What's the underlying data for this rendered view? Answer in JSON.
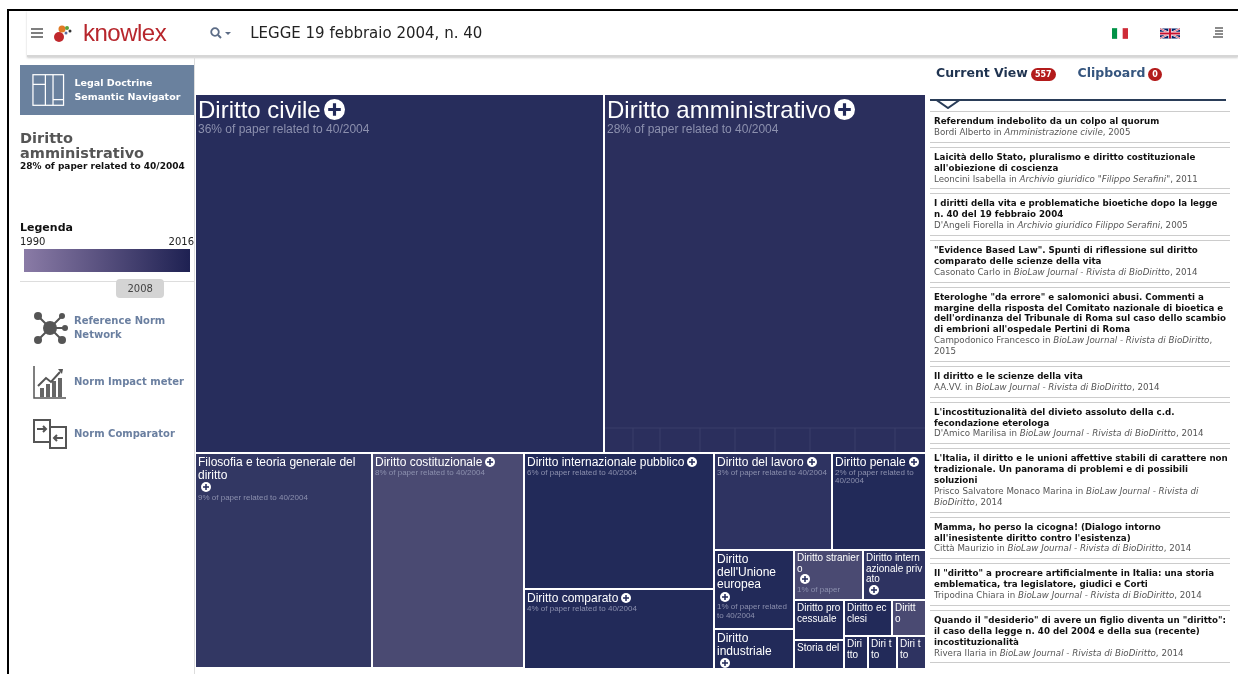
{
  "header": {
    "logo": "knowlex",
    "query": "LEGGE 19 febbraio 2004, n. 40"
  },
  "sidebar": {
    "app_title": "Legal Doctrine Semantic Navigator",
    "selected_title": "Diritto amministrativo",
    "selected_subtitle": "28% of paper related to 40/2004",
    "legend": {
      "title": "Legenda",
      "start": "1990",
      "end": "2016",
      "level": 0.7,
      "marker": "2008"
    },
    "tools": [
      {
        "kind": "network",
        "label": "Reference Norm Network"
      },
      {
        "kind": "meter",
        "label": "Norm Impact meter"
      },
      {
        "kind": "compare",
        "label": "Norm Comparator"
      }
    ]
  },
  "treemap": {
    "tiles": [
      {
        "title": "Diritto civile",
        "subtitle": "36% of paper related to 40/2004",
        "expandable": true,
        "color": "#272d5c"
      },
      {
        "title": "Diritto amministrativo",
        "subtitle": "28% of paper related to 40/2004",
        "expandable": true,
        "color": "#2b2f5d"
      },
      {
        "title": "Filosofia e teoria generale del diritto",
        "subtitle": "9% of paper related to 40/2004",
        "expandable": true,
        "color": "#323763"
      },
      {
        "title": "Diritto costituzionale",
        "subtitle": "8% of paper related to 40/2004",
        "expandable": true,
        "color": "#4a4a72"
      },
      {
        "title": "Diritto internazionale pubblico",
        "subtitle": "6% of paper related to 40/2004",
        "expandable": true,
        "color": "#222a59"
      },
      {
        "title": "Diritto comparato",
        "subtitle": "4% of paper related to 40/2004",
        "expandable": true,
        "color": "#222a59"
      },
      {
        "title": "Diritto del lavoro",
        "subtitle": "3% of paper related to 40/2004",
        "expandable": true,
        "color": "#2e3361"
      },
      {
        "title": "Diritto penale",
        "subtitle": "2% of paper related to 40/2004",
        "expandable": true,
        "color": "#222a59"
      },
      {
        "title": "Diritto dell'Unione europea",
        "subtitle": "1% of paper related to 40/2004",
        "expandable": true,
        "color": "#222a59"
      },
      {
        "title": "Diritto straniero",
        "subtitle": "1% of paper",
        "expandable": true,
        "color": "#4a4a72"
      },
      {
        "title": "Diritto internazionale privato",
        "expandable": true,
        "color": "#2e3361"
      },
      {
        "title": "Diritto processuale",
        "expandable": false,
        "color": "#222a59"
      },
      {
        "title": "Diritto ecclesi",
        "expandable": false,
        "color": "#222a59"
      },
      {
        "title": "Diritt o",
        "expandable": false,
        "color": "#4a4a72"
      },
      {
        "title": "Diritto industriale",
        "expandable": true,
        "color": "#222a59"
      },
      {
        "title": "Storia del",
        "expandable": false,
        "color": "#222a59"
      },
      {
        "title": "Diri tto",
        "expandable": false,
        "color": "#222a59"
      },
      {
        "title": "Diri tto",
        "expandable": false,
        "color": "#222a59"
      },
      {
        "title": "Diri tto",
        "expandable": false,
        "color": "#2e3361"
      }
    ]
  },
  "panel": {
    "tabs": [
      {
        "label": "Current View",
        "count": "557",
        "selected": true
      },
      {
        "label": "Clipboard",
        "count": "0",
        "selected": false
      }
    ],
    "papers": [
      {
        "title": "Referendum indebolito da un colpo al quorum",
        "source": "Bordi Alberto in *Amministrazione civile*, 2005"
      },
      {
        "title": "Laicità dello Stato, pluralismo e diritto costituzionale all'obiezione di coscienza",
        "source": "Leoncini Isabella in *Archivio giuridico \"Filippo Serafini\"*, 2011"
      },
      {
        "title": "I diritti della vita e problematiche bioetiche dopo la legge n. 40 del 19 febbraio 2004",
        "source": "D'Angeli Fiorella in *Archivio giuridico Filippo Serafini*, 2005"
      },
      {
        "title": "\"Evidence Based Law\". Spunti di riflessione sul diritto comparato delle scienze della vita",
        "source": "Casonato Carlo in *BioLaw Journal - Rivista di BioDiritto*, 2014"
      },
      {
        "title": "Eterologhe \"da errore\" e salomonici abusi. Commenti a margine della risposta del Comitato nazionale di bioetica e dell'ordinanza del Tribunale di Roma sul caso dello scambio di embrioni all'ospedale Pertini di Roma",
        "source": "Campodonico Francesco in *BioLaw Journal - Rivista di BioDiritto*, 2015"
      },
      {
        "title": "Il diritto e le scienze della vita",
        "source": "AA.VV. in *BioLaw Journal - Rivista di BioDiritto*, 2014"
      },
      {
        "title": "L'incostituzionalità del divieto assoluto della c.d. fecondazione eterologa",
        "source": "D'Amico Marilisa in *BioLaw Journal - Rivista di BioDiritto*, 2014"
      },
      {
        "title": "L'Italia, il diritto e le unioni affettive stabili di carattere non tradizionale. Un panorama di problemi e di possibili soluzioni",
        "source": "Prisco Salvatore Monaco Marina in *BioLaw Journal - Rivista di BioDiritto*, 2014"
      },
      {
        "title": "Mamma, ho perso la cicogna! (Dialogo intorno all'inesistente diritto contro l'esistenza)",
        "source": "Città Maurizio in *BioLaw Journal - Rivista di BioDiritto*, 2014"
      },
      {
        "title": "Il \"diritto\" a procreare artificialmente in Italia: una storia emblematica, tra legislatore, giudici e Corti",
        "source": "Tripodina Chiara in *BioLaw Journal - Rivista di BioDiritto*, 2014"
      },
      {
        "title": "Quando il \"desiderio\" di avere un figlio diventa un \"diritto\": il caso della legge n. 40 del 2004 e della sua (recente) incostituzionalità",
        "source": "Rivera Ilaria in *BioLaw Journal - Rivista di BioDiritto*, 2014"
      }
    ]
  }
}
